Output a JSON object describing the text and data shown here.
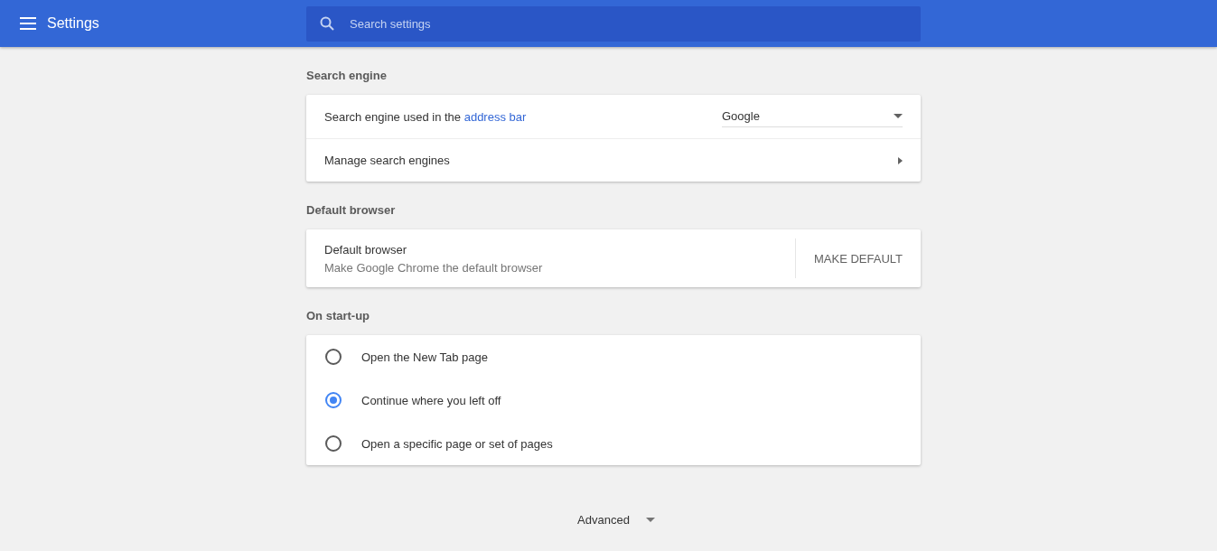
{
  "header": {
    "title": "Settings",
    "search": {
      "placeholder": "Search settings"
    }
  },
  "search_engine": {
    "title": "Search engine",
    "rows": [
      {
        "kind": "dropdown",
        "label": "Search engine used in the **address bar**",
        "value": "Google"
      },
      {
        "kind": "link",
        "label": "Manage search engines"
      }
    ]
  },
  "default_browser": {
    "title": "Default browser",
    "label": "Default browser",
    "sublabel": "Make Google Chrome the default browser",
    "button": "MAKE DEFAULT"
  },
  "startup": {
    "title": "On start-up",
    "options": [
      {
        "label": "Open the New Tab page",
        "selected": false
      },
      {
        "label": "Continue where you left off",
        "selected": true
      },
      {
        "label": "Open a specific page or set of pages",
        "selected": false
      }
    ]
  },
  "advanced": {
    "label": "Advanced"
  }
}
